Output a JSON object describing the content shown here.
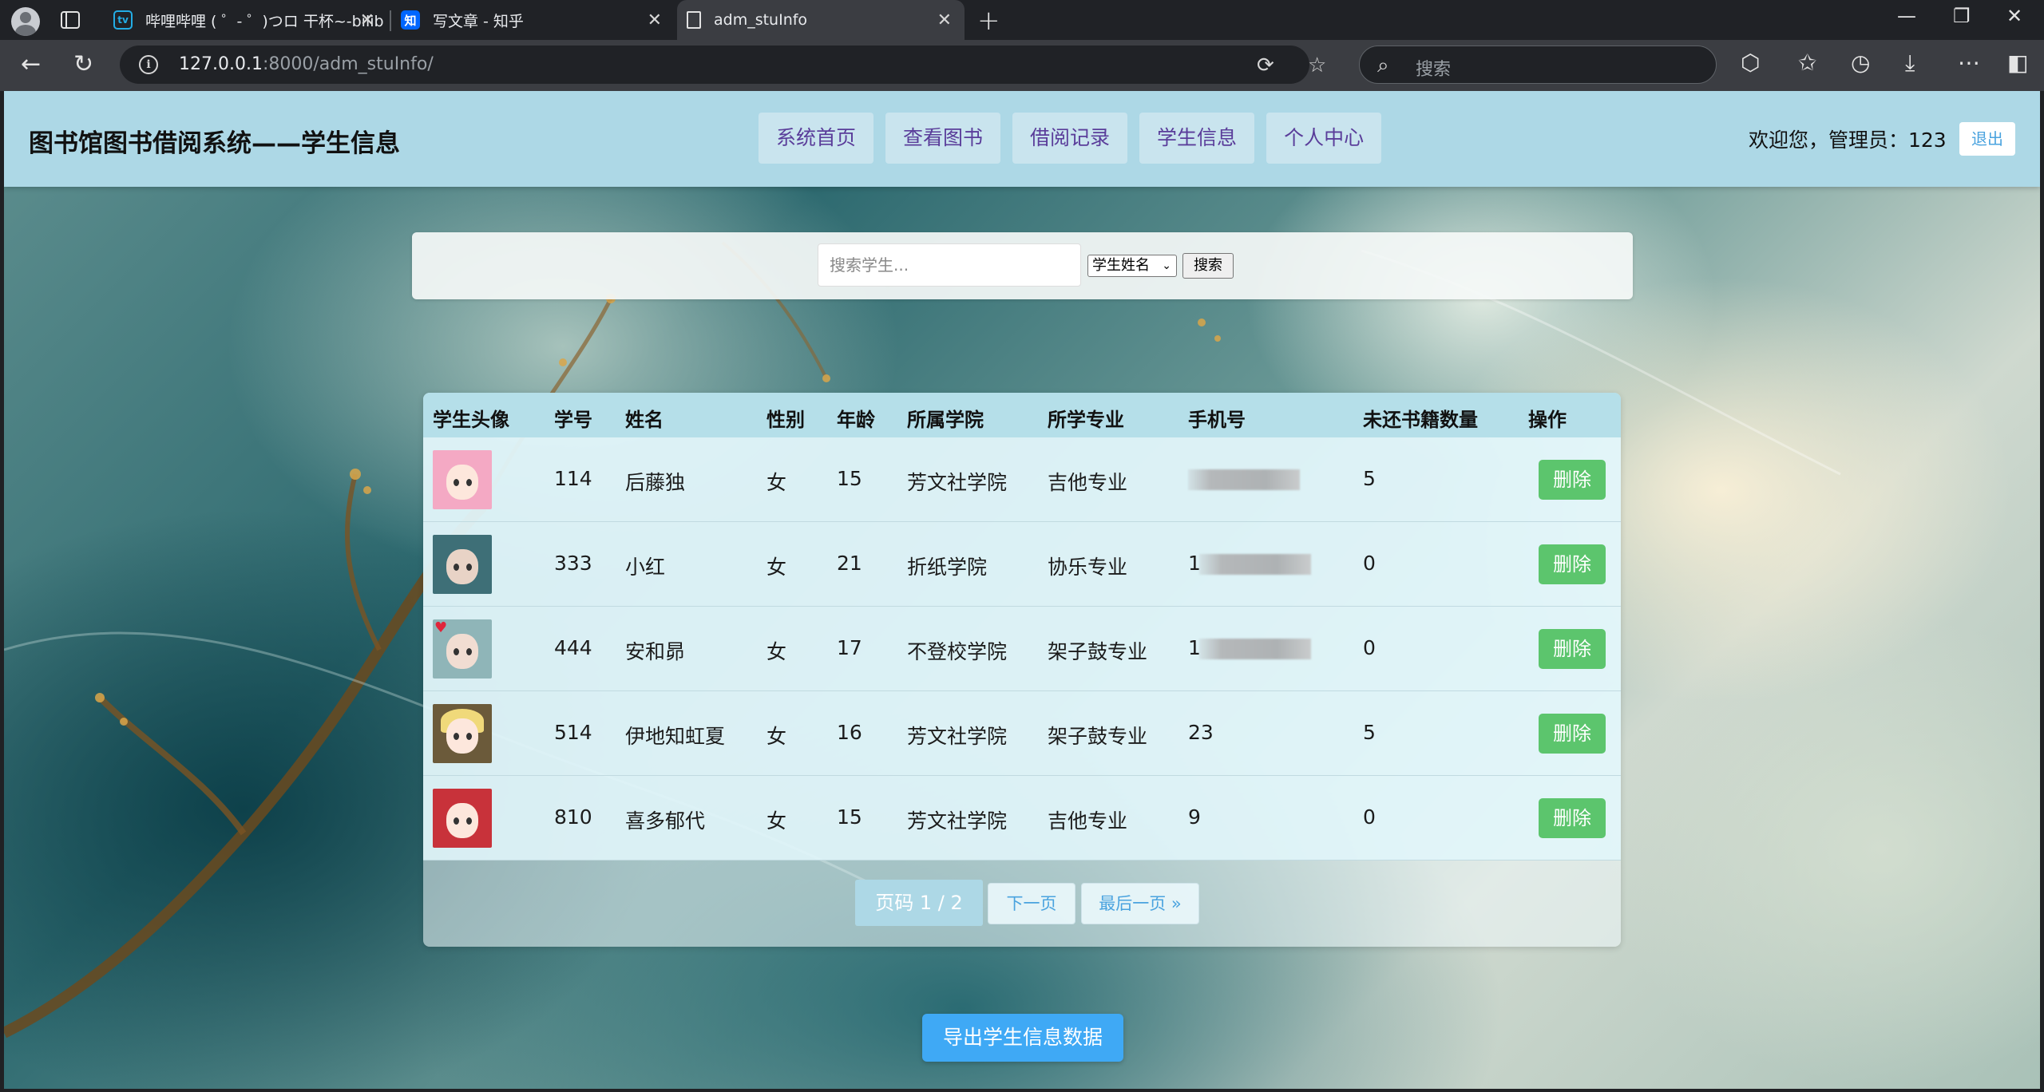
{
  "browser": {
    "tabs": [
      {
        "title": "哔哩哔哩 ( ゜- ゜)つロ 干杯~-bilibili",
        "icon": "bilibili-icon"
      },
      {
        "title": "写文章 - 知乎",
        "icon": "zhihu-icon",
        "icon_text": "知"
      },
      {
        "title": "adm_stuInfo",
        "icon": "page-icon",
        "active": true
      }
    ],
    "url_host": "127.0.0.1",
    "url_rest": ":8000/adm_stuInfo/",
    "search_placeholder": "搜索"
  },
  "header": {
    "title": "图书馆图书借阅系统——学生信息",
    "nav": [
      "系统首页",
      "查看图书",
      "借阅记录",
      "学生信息",
      "个人中心"
    ],
    "welcome": "欢迎您，管理员：123",
    "logout": "退出"
  },
  "search": {
    "placeholder": "搜索学生...",
    "select_value": "学生姓名",
    "button": "搜索"
  },
  "table": {
    "columns": [
      "学生头像",
      "学号",
      "姓名",
      "性别",
      "年龄",
      "所属学院",
      "所学专业",
      "手机号",
      "未还书籍数量",
      "操作"
    ],
    "rows": [
      {
        "id": "114",
        "name": "后藤独",
        "gender": "女",
        "age": "15",
        "college": "芳文社学院",
        "major": "吉他专业",
        "phone": "",
        "unreturned": "5",
        "action": "删除"
      },
      {
        "id": "333",
        "name": "小红",
        "gender": "女",
        "age": "21",
        "college": "折纸学院",
        "major": "协乐专业",
        "phone": "1",
        "unreturned": "0",
        "action": "删除"
      },
      {
        "id": "444",
        "name": "安和昴",
        "gender": "女",
        "age": "17",
        "college": "不登校学院",
        "major": "架子鼓专业",
        "phone": "1",
        "unreturned": "0",
        "action": "删除"
      },
      {
        "id": "514",
        "name": "伊地知虹夏",
        "gender": "女",
        "age": "16",
        "college": "芳文社学院",
        "major": "架子鼓专业",
        "phone": "23",
        "unreturned": "5",
        "action": "删除"
      },
      {
        "id": "810",
        "name": "喜多郁代",
        "gender": "女",
        "age": "15",
        "college": "芳文社学院",
        "major": "吉他专业",
        "phone": "9",
        "unreturned": "0",
        "action": "删除"
      }
    ]
  },
  "pagination": {
    "label": "页码 1 / 2",
    "next": "下一页",
    "last": "最后一页 »"
  },
  "export_button": "导出学生信息数据",
  "colors": {
    "header_bg": "#add8e6",
    "delete_button": "#5cc56d",
    "export_button": "#3fa9f5",
    "link": "#4aa3df"
  }
}
